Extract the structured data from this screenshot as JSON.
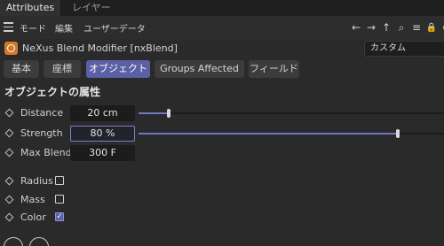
{
  "tabs": {
    "active": "Attributes",
    "inactive": "レイヤー"
  },
  "menu": {
    "items": [
      "モード",
      "編集",
      "ユーザーデータ"
    ]
  },
  "toolbar": {
    "icons": [
      "back-arrow-icon",
      "forward-arrow-icon",
      "up-arrow-icon",
      "search-icon",
      "filter-icon",
      "lock-icon",
      "add-icon"
    ],
    "glyphs": [
      "←",
      "→",
      "↑",
      "⌕",
      "≡",
      "🔒",
      "⊕"
    ]
  },
  "object": {
    "name": "NeXus Blend Modifier [nxBlend]",
    "mode": "カスタム",
    "icon_color": "#d07a2a"
  },
  "property_tabs": [
    {
      "label": "基本",
      "selected": false
    },
    {
      "label": "座標",
      "selected": false
    },
    {
      "label": "オブジェクト",
      "selected": true
    },
    {
      "label": "Groups Affected",
      "selected": false
    },
    {
      "label": "フィールド",
      "selected": false
    }
  ],
  "section": {
    "title": "オブジェクトの属性"
  },
  "params": {
    "distance": {
      "label": "Distance",
      "value": "20 cm",
      "slider_fraction": 0.1
    },
    "strength": {
      "label": "Strength",
      "value": "80 %",
      "slider_fraction": 0.85
    },
    "max_blend": {
      "label": "Max Blend",
      "value": "300 F"
    }
  },
  "checks": {
    "radius": {
      "label": "Radius",
      "checked": false
    },
    "mass": {
      "label": "Mass",
      "checked": false
    },
    "color": {
      "label": "Color",
      "checked": true
    }
  },
  "colors": {
    "accent": "#5a5fa6",
    "slider": "#6f74c4"
  }
}
